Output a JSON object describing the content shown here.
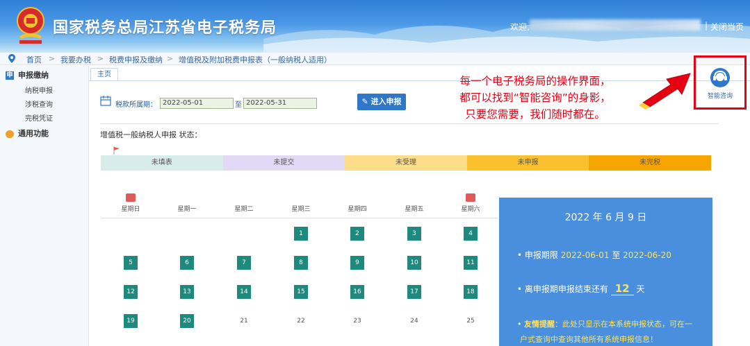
{
  "header": {
    "site_title": "国家税务总局江苏省电子税务局",
    "welcome_prefix": "欢迎,",
    "separator": "|",
    "close_page": "关闭当页"
  },
  "breadcrumb": [
    "首页",
    "我要办税",
    "税费申报及缴纳",
    "增值税及附加税费申报表（一般纳税人适用）"
  ],
  "breadcrumb_sep": ">",
  "sidebar": {
    "section1": "申报缴纳",
    "items": [
      "纳税申报",
      "涉税查询",
      "完税凭证"
    ],
    "section2": "通用功能"
  },
  "tab": "主页",
  "period": {
    "label": "税款所属期：",
    "start": "2022-05-01",
    "to": "至",
    "end": "2022-05-31",
    "button": "进入申报"
  },
  "status": {
    "title": "增值税一般纳税人申报 状态：",
    "segments": [
      {
        "label": "未填表",
        "color": "#d9ecec"
      },
      {
        "label": "未提交",
        "color": "#e2d9f6"
      },
      {
        "label": "未受理",
        "color": "#fddc8a"
      },
      {
        "label": "未申报",
        "color": "#fbc02d"
      },
      {
        "label": "未完税",
        "color": "#f7a500"
      }
    ]
  },
  "calendar": {
    "weekdays": [
      "星期日",
      "星期一",
      "星期二",
      "星期三",
      "星期四",
      "星期五",
      "星期六"
    ],
    "weeks": [
      [
        null,
        null,
        null,
        "1",
        "2",
        "3",
        "4"
      ],
      [
        "5",
        "6",
        "7",
        "8",
        "9",
        "10",
        "11"
      ],
      [
        "12",
        "13",
        "14",
        "15",
        "16",
        "17",
        "18"
      ],
      [
        "19",
        "20",
        "21",
        "22",
        "23",
        "24",
        "25"
      ]
    ],
    "highlighted": [
      "1",
      "2",
      "3",
      "4",
      "5",
      "6",
      "7",
      "8",
      "9",
      "10",
      "11",
      "12",
      "13",
      "14",
      "15",
      "16",
      "17",
      "18",
      "19",
      "20"
    ]
  },
  "info": {
    "date": "2022 年 6 月 9 日",
    "period_label": "申报期限",
    "period_start": "2022-06-01",
    "period_to": "至",
    "period_end": "2022-06-20",
    "remain_prefix": "离申报期申报结束还有",
    "remain_days": "12",
    "remain_suffix": "天",
    "tip_label": "友情提醒",
    "tip_text": "：此处只显示在本系统申报状态，可在一",
    "tip_text2": "户式查询中查询其他所有系统申报信息！"
  },
  "annotation": {
    "line1": "每一个电子税务局的操作界面，",
    "line2": "都可以找到“智能咨询”的身影，",
    "line3": "只要您需要，我们随时都在。"
  },
  "assistant": {
    "label": "智能咨询"
  },
  "colors": {
    "accent": "#2f78c8",
    "calendar_day": "#1e8a7d",
    "info_bg": "#4a8fde",
    "annotation": "#e60012"
  }
}
